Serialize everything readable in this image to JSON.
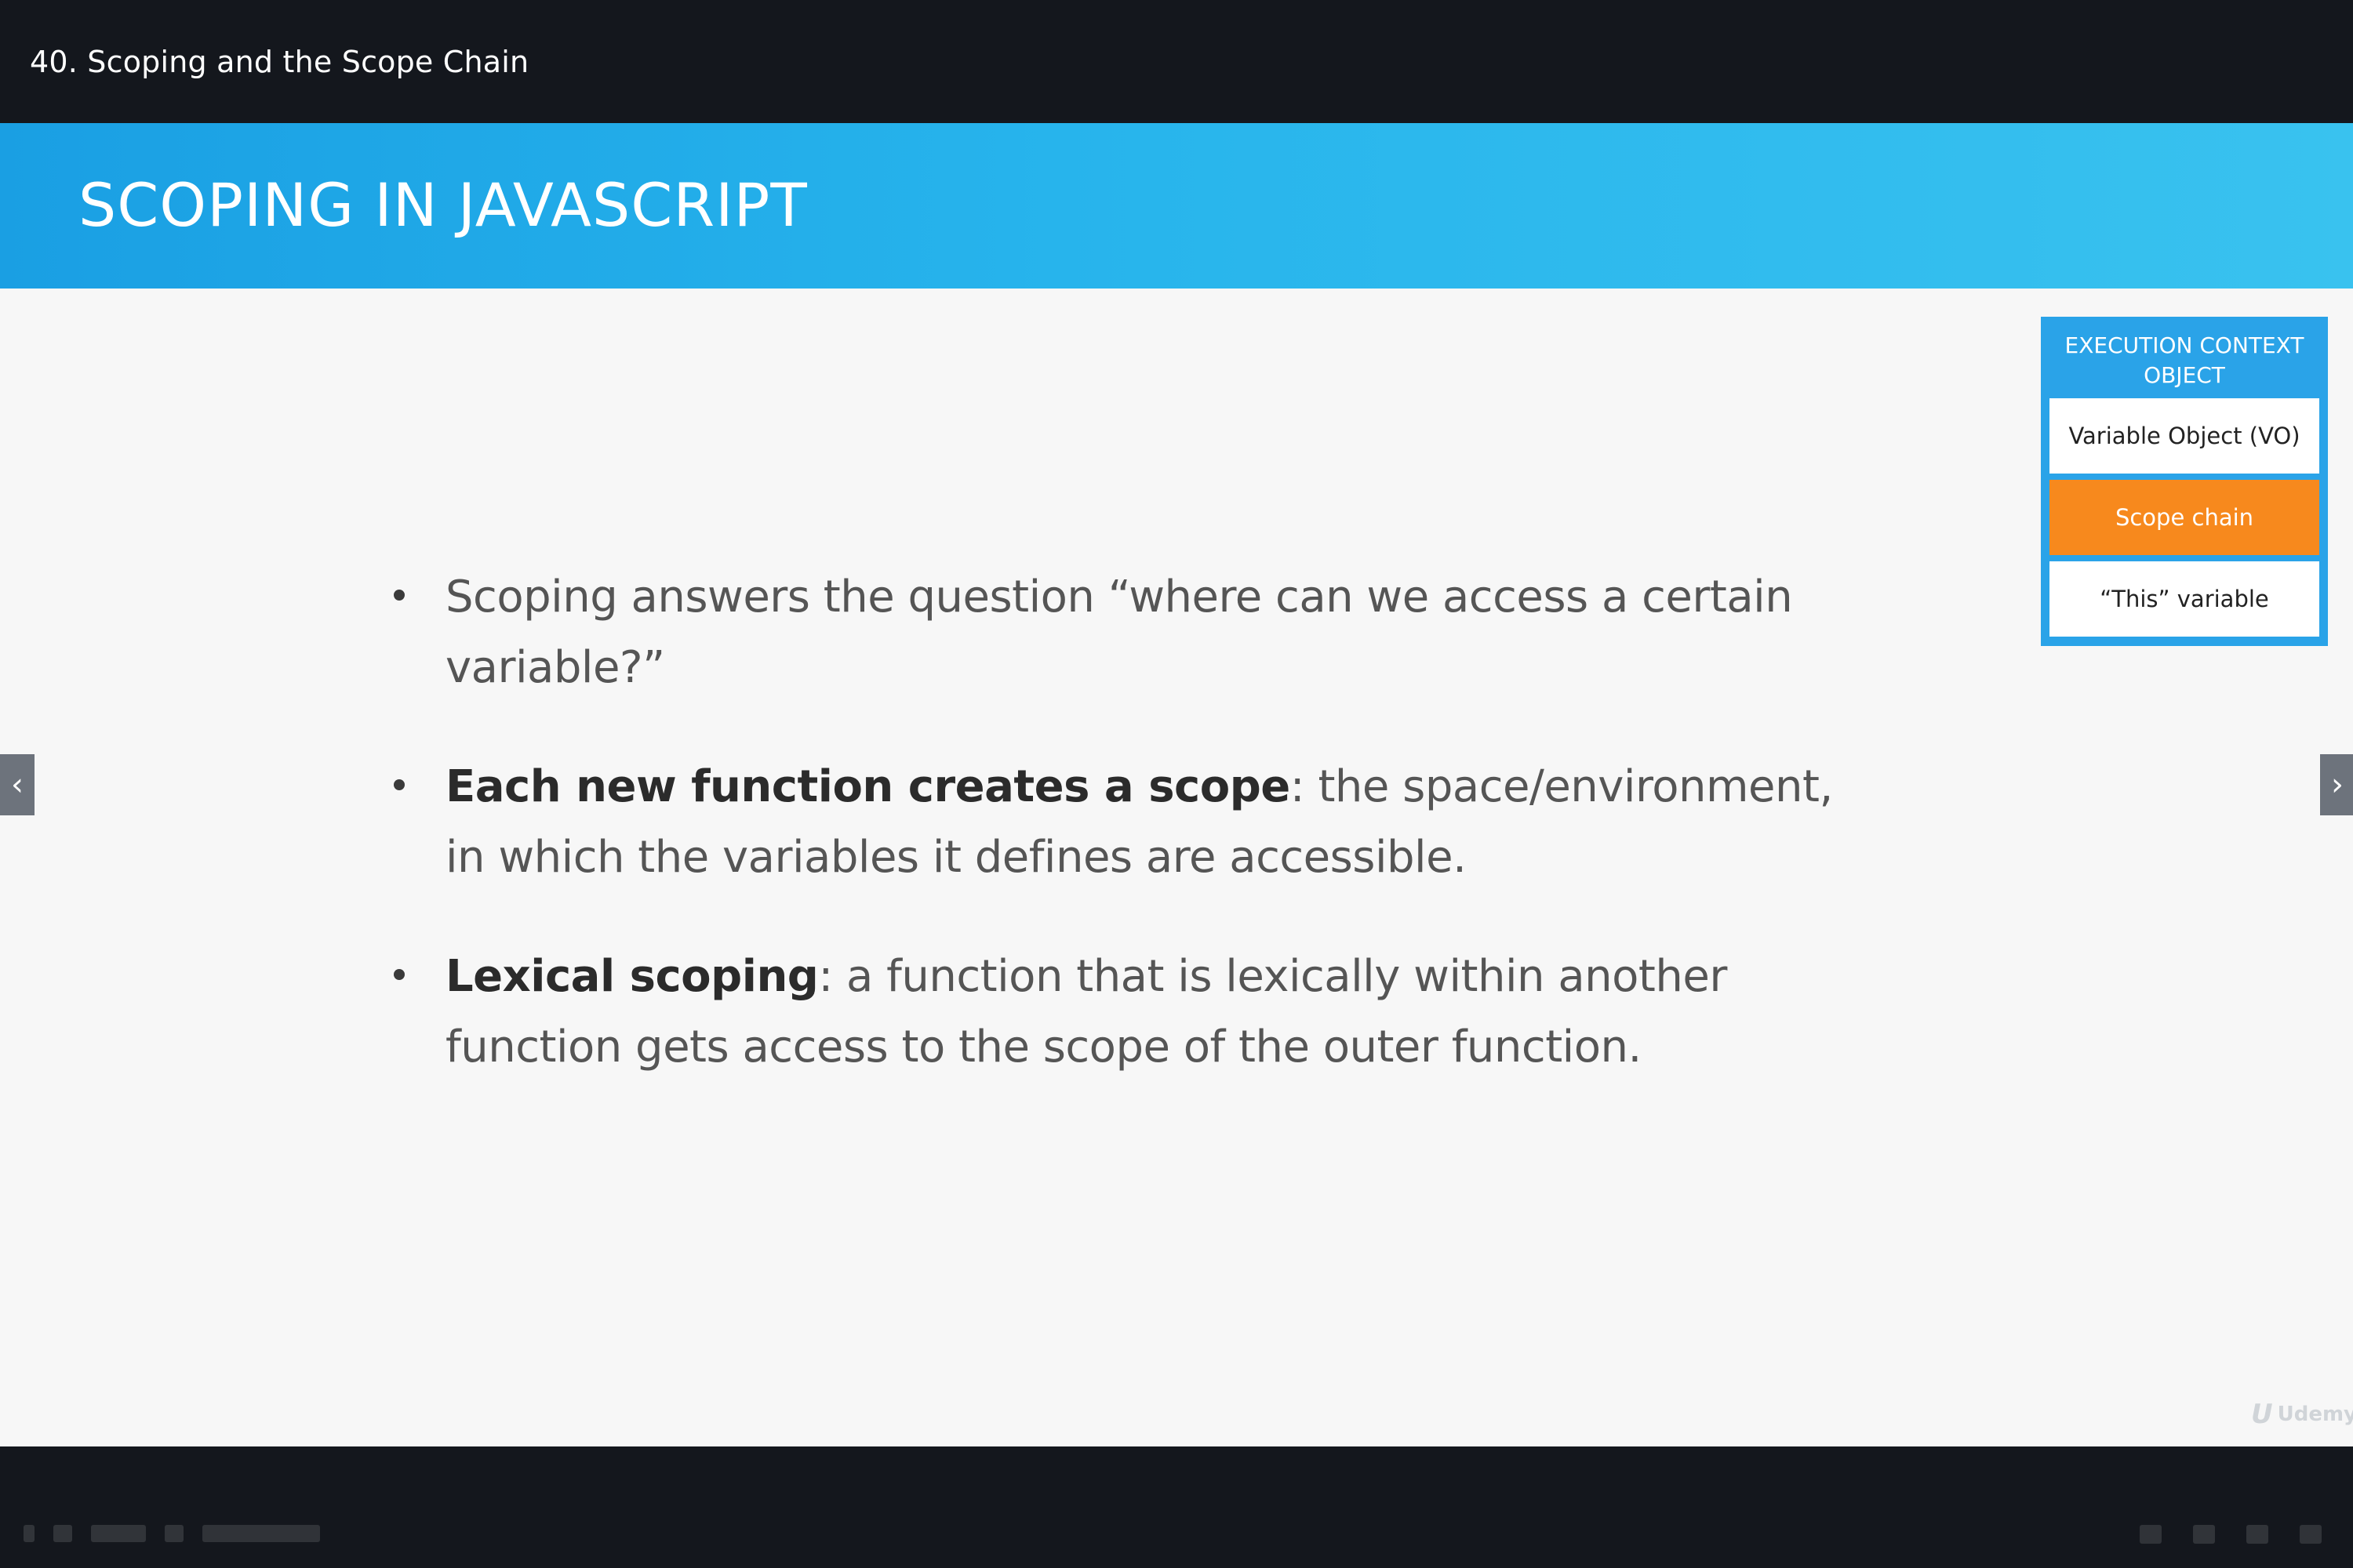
{
  "player": {
    "lecture_title": "40. Scoping and the Scope Chain",
    "prev_arrow": "‹",
    "next_arrow": "›"
  },
  "slide": {
    "title": "SCOPING IN JAVASCRIPT",
    "bullets": [
      {
        "bold": "",
        "text": "Scoping answers the question “where can we access a certain variable?”"
      },
      {
        "bold": "Each new function creates a scope",
        "text": ": the space/environment, in which the variables it defines are accessible."
      },
      {
        "bold": "Lexical scoping",
        "text": ": a function that is lexically within another function gets access to the scope of the outer function."
      }
    ],
    "execution_context": {
      "title": "EXECUTION CONTEXT OBJECT",
      "items": [
        {
          "label": "Variable Object (VO)",
          "active": false
        },
        {
          "label": "Scope chain",
          "active": true
        },
        {
          "label": "“This” variable",
          "active": false
        }
      ]
    },
    "watermark": "Udemy"
  },
  "colors": {
    "header_blue": "#1a9fe3",
    "active_orange": "#f7891d",
    "player_bg": "#14171d"
  }
}
